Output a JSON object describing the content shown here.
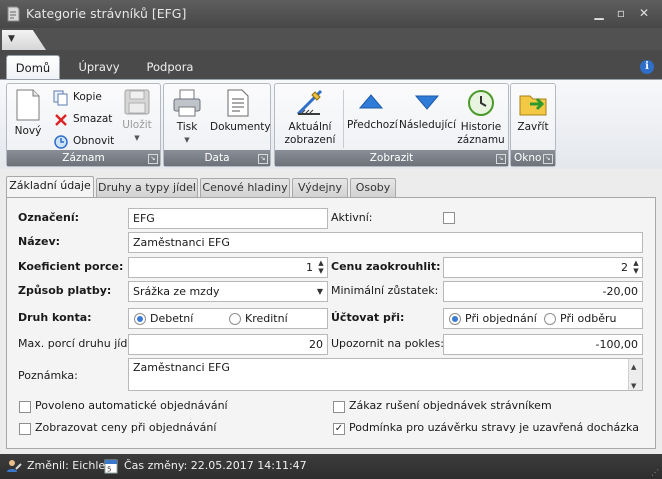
{
  "window": {
    "title": "Kategorie strávníků [EFG]"
  },
  "ribbon_tabs": [
    "Domů",
    "Úpravy",
    "Podpora"
  ],
  "ribbon": {
    "groups": {
      "zaznam": "Záznam",
      "data": "Data",
      "zobrazit": "Zobrazit",
      "okno": "Okno"
    },
    "buttons": {
      "novy": "Nový",
      "kopie": "Kopie",
      "smazat": "Smazat",
      "obnovit": "Obnovit",
      "ulozit": "Uložit",
      "tisk": "Tisk",
      "dokumenty": "Dokumenty",
      "aktualni_1": "Aktuální",
      "aktualni_2": "zobrazení",
      "predchozi": "Předchozí",
      "nasledujici": "Následující",
      "historie_1": "Historie",
      "historie_2": "záznamu",
      "zavrit": "Zavřít"
    }
  },
  "tabs": [
    "Základní údaje",
    "Druhy a typy jídel",
    "Cenové hladiny",
    "Výdejny",
    "Osoby"
  ],
  "form": {
    "oznaceni": {
      "label": "Označení:",
      "value": "EFG"
    },
    "aktivni": {
      "label": "Aktivní:",
      "checked": false
    },
    "nazev": {
      "label": "Název:",
      "value": "Zaměstnanci EFG"
    },
    "koeficient": {
      "label": "Koeficient porce:",
      "value": "1"
    },
    "cena_zaokrouhlit": {
      "label": "Cenu zaokrouhlit:",
      "value": "2"
    },
    "zpusob_platby": {
      "label": "Způsob platby:",
      "value": "Srážka ze mzdy"
    },
    "min_zustatek": {
      "label": "Minimální zůstatek:",
      "value": "-20,00"
    },
    "druh_konta": {
      "label": "Druh konta:",
      "options": [
        "Debetní",
        "Kreditní"
      ],
      "selected": "Debetní"
    },
    "uctovat_pri": {
      "label": "Účtovat při:",
      "options": [
        "Při objednání",
        "Při odběru"
      ],
      "selected": "Při objednání"
    },
    "max_porci": {
      "label": "Max. porcí druhu jídla:",
      "value": "20"
    },
    "upozornit": {
      "label": "Upozornit na pokles:",
      "value": "-100,00"
    },
    "poznamka": {
      "label": "Poznámka:",
      "value": "Zaměstnanci EFG"
    },
    "checks": {
      "povoleno": {
        "label": "Povoleno automatické objednávání",
        "checked": false
      },
      "zakaz": {
        "label": "Zákaz rušení objednávek strávníkem",
        "checked": false
      },
      "zobrazovat": {
        "label": "Zobrazovat ceny při objednávání",
        "checked": false
      },
      "podminka": {
        "label": "Podmínka pro uzávěrku stravy je uzavřená docházka",
        "checked": true
      }
    }
  },
  "status": {
    "zmenil": "Změnil: Eichler",
    "cas_zmeny": "Čas změny: 22.05.2017 14:11:47"
  },
  "colors": {
    "accent": "#3a7bd5",
    "title_bar": "#4e4e4e",
    "group_label": "#7a7f87"
  }
}
